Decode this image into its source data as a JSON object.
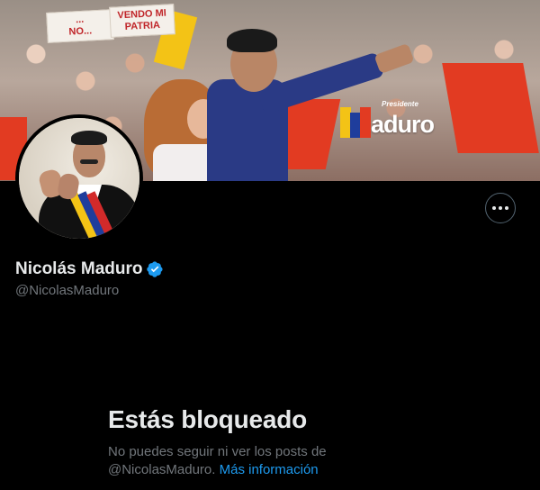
{
  "banner": {
    "sign_1": "...\nNO...",
    "sign_2": "VENDO MI\nPATRIA",
    "brand_small": "Presidente",
    "brand_word": "aduro",
    "colors": {
      "red": "#e23b22",
      "yellow": "#f3c316",
      "blue": "#1f3d9c"
    }
  },
  "profile": {
    "display_name": "Nicolás Maduro",
    "handle": "@NicolasMaduro",
    "verified": true,
    "verified_color": "#1d9bf0",
    "more_button_icon": "more-horizontal-icon"
  },
  "blocked": {
    "title": "Estás bloqueado",
    "message_line1": "No puedes seguir ni ver los posts de",
    "message_line2": "@NicolasMaduro.",
    "link_text": "Más información"
  }
}
